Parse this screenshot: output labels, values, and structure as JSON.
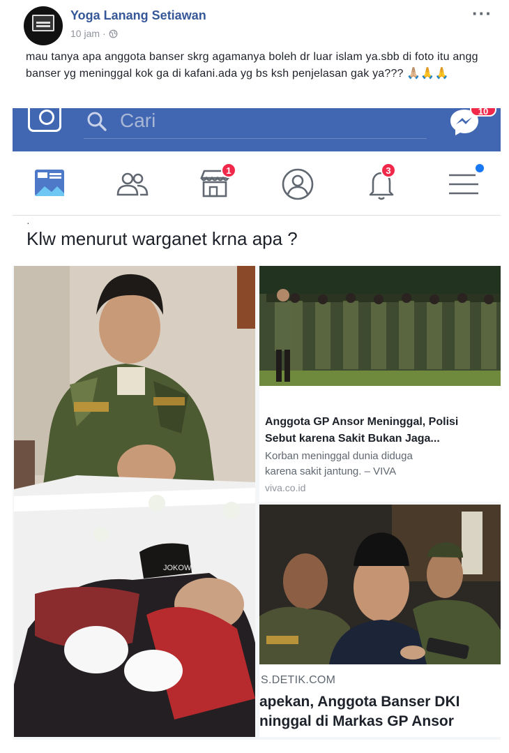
{
  "post": {
    "author": "Yoga Lanang Setiawan",
    "time": "10 jam",
    "separator": "·",
    "more": "···",
    "text": "mau tanya apa anggota banser skrg agamanya boleh dr luar islam ya.sbb di foto itu angg banser yg meninggal kok ga di kafani.ada yg bs ksh penjelasan gak ya??? 🙏🏼🙏🙏"
  },
  "screenshot": {
    "search_placeholder": "Cari",
    "messenger_badge": "10",
    "nav": {
      "marketplace_badge": "1",
      "notifications_badge": "3"
    },
    "question_dot": "·",
    "question": "Klw menurut warganet krna apa ?",
    "card1": {
      "headline_line1": "Anggota GP Ansor Meninggal, Polisi",
      "headline_line2": "Sebut karena Sakit Bukan Jaga...",
      "desc_line1": "Korban meninggal dunia diduga",
      "desc_line2": "karena sakit jantung. – VIVA",
      "domain": "viva.co.id"
    },
    "card2": {
      "domain": "S.DETIK.COM",
      "headline_line1": "apekan, Anggota Banser DKI",
      "headline_line2": "ninggal di Markas GP Ansor"
    },
    "photo_texts": {
      "cap_label": "JOKOWI"
    }
  },
  "colors": {
    "fb_blue": "#4267b2",
    "link_blue": "#365899",
    "badge_red": "#f02849"
  }
}
